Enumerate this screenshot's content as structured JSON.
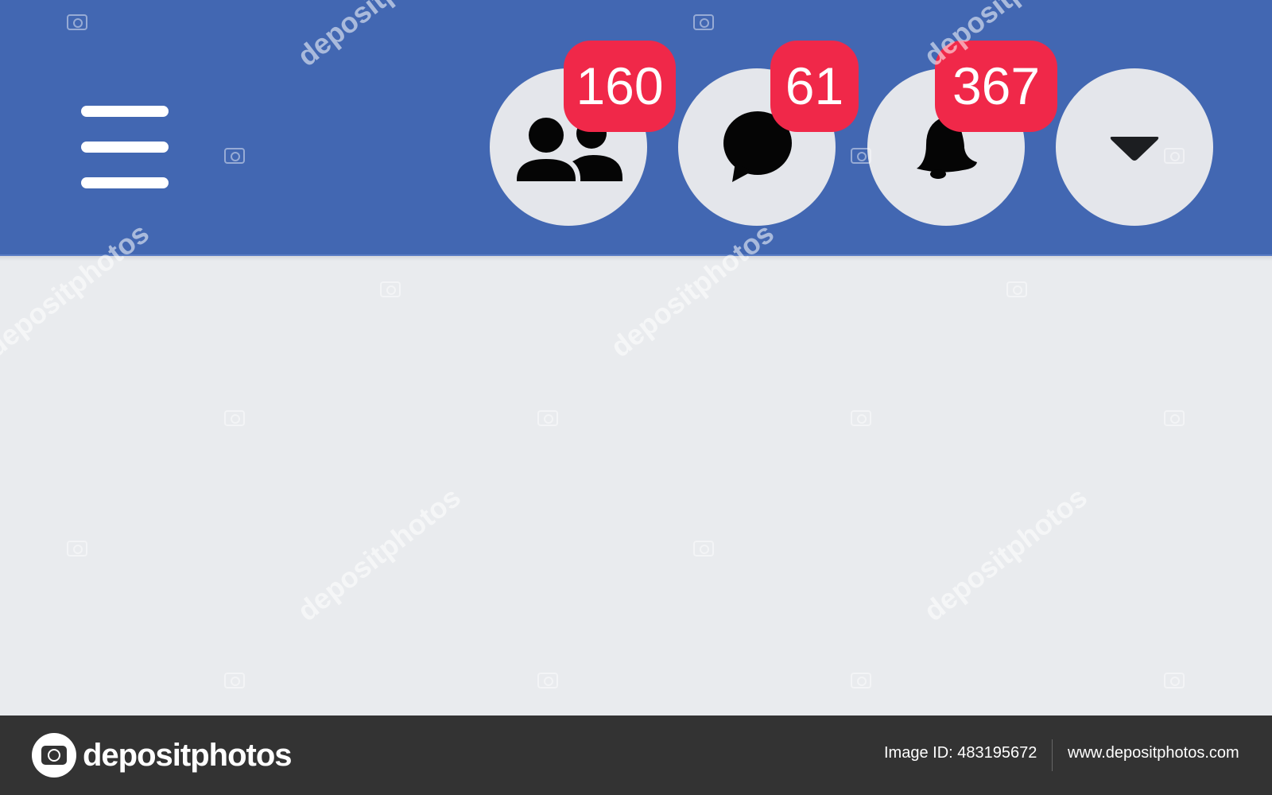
{
  "navbar": {
    "background_color": "#4267b2",
    "menu_icon": "hamburger-menu-icon",
    "buttons": [
      {
        "id": "friends",
        "icon": "friends-icon",
        "badge": "160"
      },
      {
        "id": "messages",
        "icon": "messenger-icon",
        "badge": "61"
      },
      {
        "id": "notifications",
        "icon": "bell-icon",
        "badge": "367"
      },
      {
        "id": "account-menu",
        "icon": "caret-down-icon",
        "badge": ""
      }
    ],
    "badge_color": "#f02849",
    "button_color": "#e4e6eb"
  },
  "content": {
    "background_color": "#e9ebee"
  },
  "watermark": {
    "text": "depositphotos"
  },
  "footer": {
    "logo_text": "depositphotos",
    "image_id": "Image ID: 483195672",
    "url": "www.depositphotos.com"
  }
}
